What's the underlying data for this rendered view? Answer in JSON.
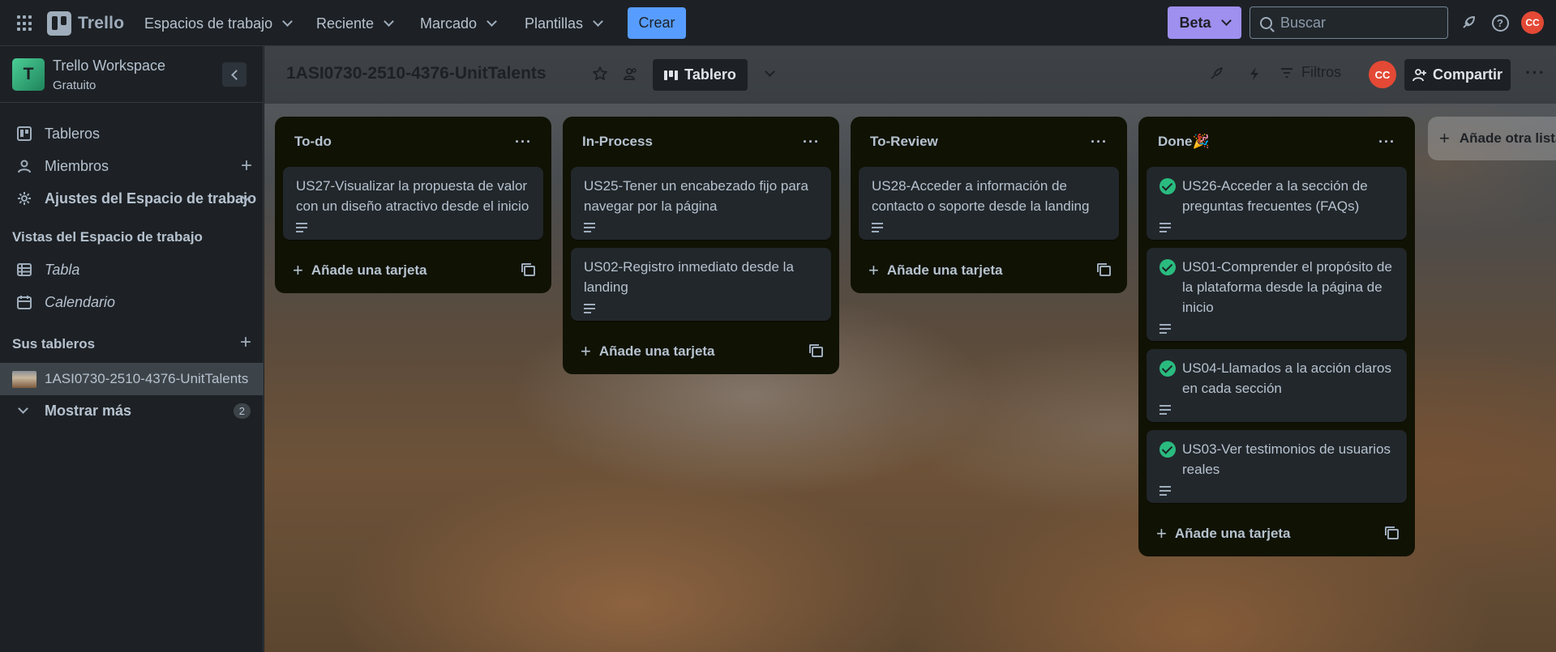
{
  "topnav": {
    "logo_text": "Trello",
    "menus": [
      "Espacios de trabajo",
      "Reciente",
      "Marcado",
      "Plantillas"
    ],
    "create_label": "Crear",
    "beta_label": "Beta",
    "search_placeholder": "Buscar",
    "avatar_initials": "CC"
  },
  "sidebar": {
    "workspace_initial": "T",
    "workspace_name": "Trello Workspace",
    "workspace_plan": "Gratuito",
    "nav": {
      "boards": "Tableros",
      "members": "Miembros",
      "settings": "Ajustes del Espacio de trabajo"
    },
    "views_heading": "Vistas del Espacio de trabajo",
    "views": {
      "table": "Tabla",
      "calendar": "Calendario"
    },
    "boards_heading": "Sus tableros",
    "current_board": "1ASI0730-2510-4376-UnitTalents",
    "show_more": "Mostrar más",
    "show_more_count": "2"
  },
  "board": {
    "title": "1ASI0730-2510-4376-UnitTalents",
    "view_label": "Tablero",
    "filters_label": "Filtros",
    "member_initials": "CC",
    "share_label": "Compartir",
    "add_card_label": "Añade una tarjeta",
    "add_list_label": "Añade otra lista",
    "lists": {
      "todo": {
        "title": "To-do",
        "cards": [
          "US27-Visualizar la propuesta de valor con un diseño atractivo desde el inicio"
        ]
      },
      "inprocess": {
        "title": "In-Process",
        "cards": [
          "US25-Tener un encabezado fijo para navegar por la página",
          "US02-Registro inmediato desde la landing"
        ]
      },
      "toreview": {
        "title": "To-Review",
        "cards": [
          "US28-Acceder a información de contacto o soporte desde la landing"
        ]
      },
      "done": {
        "title": "Done🎉",
        "cards": [
          "US26-Acceder a la sección de preguntas frecuentes (FAQs)",
          "US01-Comprender el propósito de la plataforma desde la página de inicio",
          "US04-Llamados a la acción claros en cada sección",
          "US03-Ver testimonios de usuarios reales"
        ]
      }
    }
  },
  "colors": {
    "crear": "#579dff",
    "beta": "#9f8fef",
    "avatar": "#e34935",
    "done_check": "#2abb7f",
    "list_bg": "#101204",
    "card_bg": "#22272b"
  }
}
